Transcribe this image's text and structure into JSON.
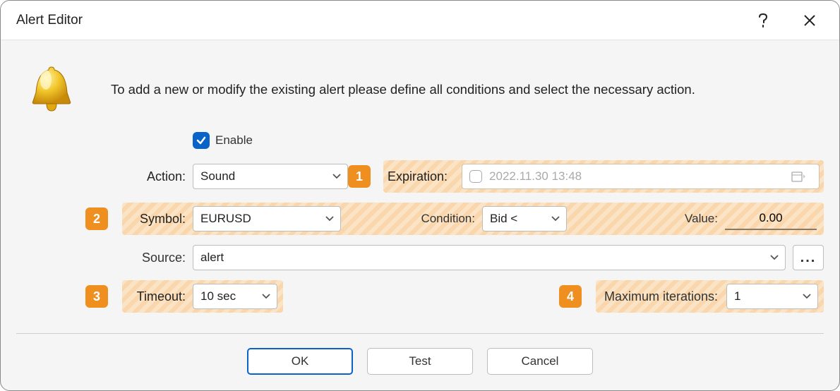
{
  "window": {
    "title": "Alert Editor"
  },
  "intro": "To add a new or modify the existing alert please define all conditions and select the necessary action.",
  "enable": {
    "label": "Enable",
    "checked": true
  },
  "badges": {
    "expiration": "1",
    "symbol": "2",
    "timeout": "3",
    "iterations": "4"
  },
  "labels": {
    "action": "Action:",
    "expiration": "Expiration:",
    "symbol": "Symbol:",
    "condition": "Condition:",
    "value": "Value:",
    "source": "Source:",
    "timeout": "Timeout:",
    "max_iterations": "Maximum iterations:"
  },
  "fields": {
    "action": "Sound",
    "expiration_enabled": false,
    "expiration_date": "2022.11.30 13:48",
    "symbol": "EURUSD",
    "condition": "Bid <",
    "value": "0.00",
    "source": "alert",
    "timeout": "10 sec",
    "max_iterations": "1"
  },
  "buttons": {
    "ok": "OK",
    "test": "Test",
    "cancel": "Cancel",
    "more": "..."
  }
}
